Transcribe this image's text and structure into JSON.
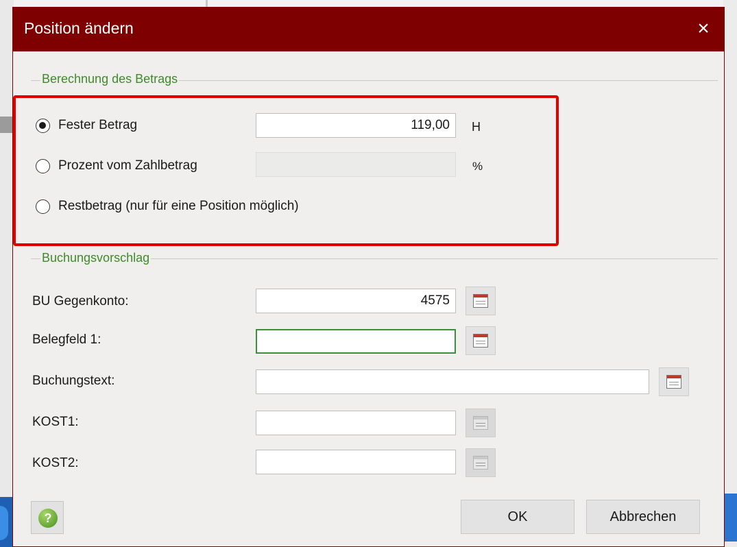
{
  "dialog": {
    "title": "Position ändern",
    "close_icon": "×"
  },
  "berechnung": {
    "group_label": "Berechnung des Betrags",
    "options": [
      {
        "label": "Fester Betrag",
        "checked": true
      },
      {
        "label": "Prozent vom Zahlbetrag",
        "checked": false
      },
      {
        "label": "Restbetrag (nur für eine Position möglich)",
        "checked": false
      }
    ],
    "fester_betrag_value": "119,00",
    "fester_betrag_unit": "H",
    "prozent_value": "",
    "prozent_unit": "%"
  },
  "buchung": {
    "group_label": "Buchungsvorschlag",
    "fields": {
      "bu_gegenkonto": {
        "label": "BU Gegenkonto:",
        "value": "4575"
      },
      "belegfeld1": {
        "label": "Belegfeld 1:",
        "value": ""
      },
      "buchungstext": {
        "label": "Buchungstext:",
        "value": ""
      },
      "kost1": {
        "label": "KOST1:",
        "value": ""
      },
      "kost2": {
        "label": "KOST2:",
        "value": ""
      }
    }
  },
  "footer": {
    "help_label": "?",
    "ok_label": "OK",
    "cancel_label": "Abbrechen"
  },
  "colors": {
    "titlebar": "#7e0000",
    "group_label": "#3f8a2a",
    "highlight": "#e00000"
  }
}
